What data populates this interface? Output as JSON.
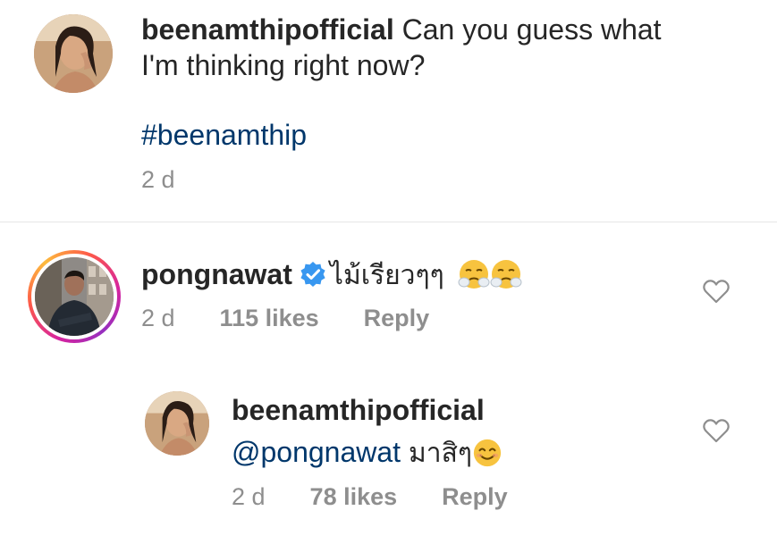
{
  "post": {
    "username": "beenamthipofficial",
    "caption_line1": "Can you guess what",
    "caption_line2": "I'm thinking right now?",
    "hashtag": "#beenamthip",
    "time": "2 d",
    "avatar_icon": "profile-photo"
  },
  "comment": {
    "username": "pongnawat",
    "verified_icon": "verified-badge-icon",
    "text": "ไม้เรียวๆๆ",
    "emojis": [
      "steam-from-nose-emoji",
      "steam-from-nose-emoji"
    ],
    "time": "2 d",
    "likes": "115 likes",
    "reply_label": "Reply",
    "like_icon": "heart-icon"
  },
  "reply": {
    "username": "beenamthipofficial",
    "mention": "@pongnawat",
    "text": "มาสิๆ",
    "emoji": "smiling-face-emoji",
    "time": "2 d",
    "likes": "78 likes",
    "reply_label": "Reply",
    "like_icon": "heart-icon"
  },
  "colors": {
    "text": "#262626",
    "meta": "#8e8e8e",
    "link": "#00376b",
    "verified": "#3897f0",
    "divider": "#e6e6e6"
  }
}
